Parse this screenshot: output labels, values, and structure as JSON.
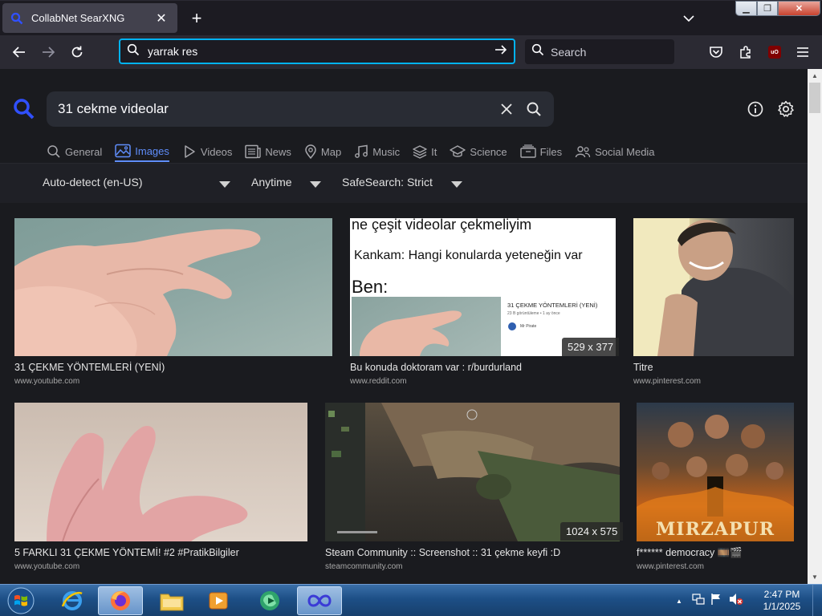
{
  "browser": {
    "tab_title": "CollabNet SearXNG",
    "url_value": "yarrak res",
    "search_placeholder": "Search"
  },
  "searx": {
    "query": "31 cekme videolar",
    "categories": [
      {
        "label": "General",
        "icon": "search-icon"
      },
      {
        "label": "Images",
        "icon": "image-icon",
        "active": true
      },
      {
        "label": "Videos",
        "icon": "play-icon"
      },
      {
        "label": "News",
        "icon": "newspaper-icon"
      },
      {
        "label": "Map",
        "icon": "map-pin-icon"
      },
      {
        "label": "Music",
        "icon": "music-note-icon"
      },
      {
        "label": "It",
        "icon": "layers-icon"
      },
      {
        "label": "Science",
        "icon": "school-icon"
      },
      {
        "label": "Files",
        "icon": "files-icon"
      },
      {
        "label": "Social Media",
        "icon": "people-icon"
      }
    ],
    "filters": {
      "language": "Auto-detect (en-US)",
      "time": "Anytime",
      "safesearch": "SafeSearch: Strict"
    },
    "results": [
      {
        "title": "31 ÇEKME YÖNTEMLERİ (YENİ)",
        "url": "www.youtube.com"
      },
      {
        "title": "Bu konuda doktoram var : r/burdurland",
        "url": "www.reddit.com",
        "dims": "529 x 377",
        "meme_lines": [
          "ne çeşit videolar çekmeliyim",
          "Kankam: Hangi konularda yeteneğin var",
          "Ben:"
        ],
        "inner_card": {
          "title": "31 ÇEKME YÖNTEMLERİ (YENİ)",
          "meta": "23 B görüntüleme • 1 ay önce",
          "channel": "Mr Pirate"
        }
      },
      {
        "title": "Titre",
        "url": "www.pinterest.com"
      },
      {
        "title": "5 FARKLI 31 ÇEKME YÖNTEMİ! #2 #PratikBilgiler",
        "url": "www.youtube.com"
      },
      {
        "title": "Steam Community :: Screenshot :: 31 çekme keyfi :D",
        "url": "steamcommunity.com",
        "dims": "1024 x 575"
      },
      {
        "title": "f****** democracy 🎞️🎬",
        "url": "www.pinterest.com",
        "poster_text": "MIRZAPUR"
      }
    ]
  },
  "taskbar": {
    "time": "2:47 PM",
    "date": "1/1/2025"
  },
  "colors": {
    "accent": "#5f8dfa",
    "url_focus": "#00b3f4",
    "page_bg": "#1a1b1f"
  }
}
